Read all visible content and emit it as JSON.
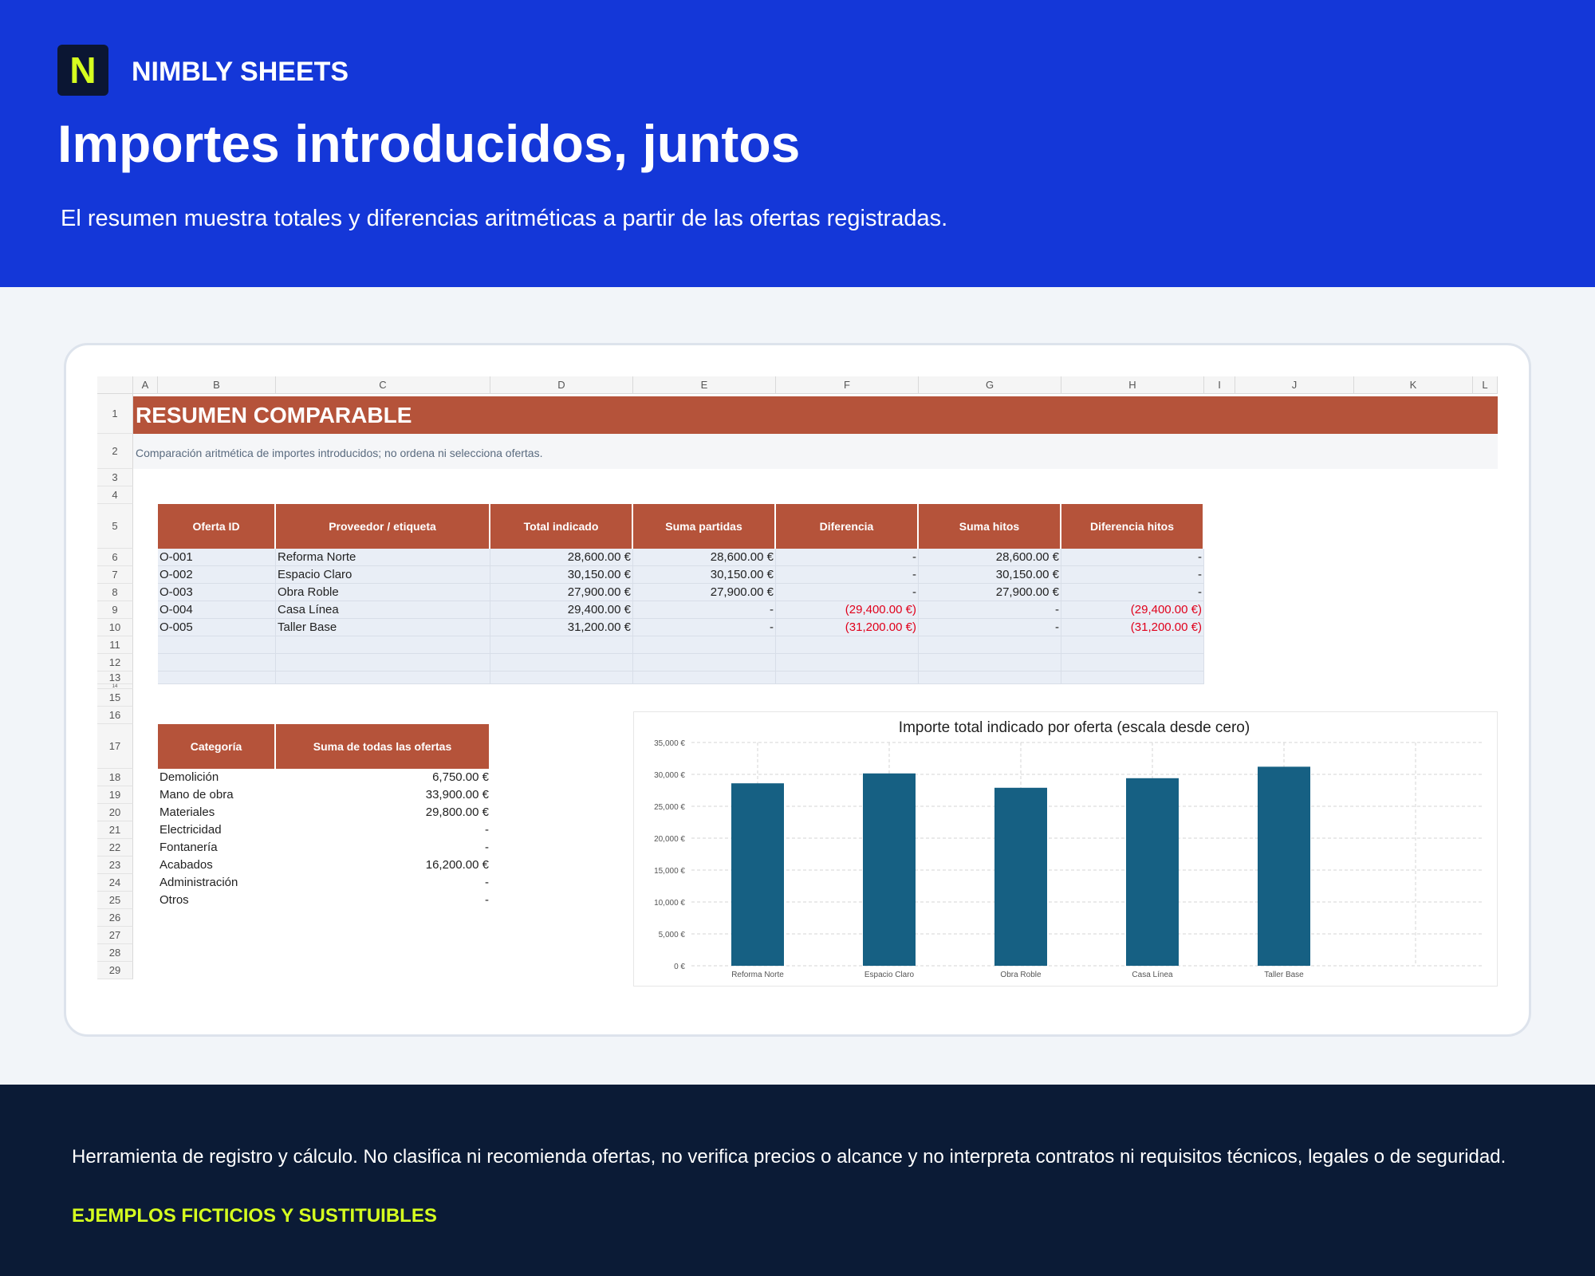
{
  "header": {
    "logo_letter": "N",
    "brand": "NIMBLY SHEETS",
    "title": "Importes introducidos, juntos",
    "subtitle": "El resumen muestra totales y diferencias aritméticas a partir de las ofertas registradas."
  },
  "sheet": {
    "columns": [
      "A",
      "B",
      "C",
      "D",
      "E",
      "F",
      "G",
      "H",
      "I",
      "J",
      "K",
      "L"
    ],
    "rows": [
      "1",
      "2",
      "3",
      "4",
      "5",
      "6",
      "7",
      "8",
      "9",
      "10",
      "11",
      "12",
      "13",
      "14",
      "15",
      "16",
      "17",
      "18",
      "19",
      "20",
      "21",
      "22",
      "23",
      "24",
      "25",
      "26",
      "27",
      "28",
      "29"
    ],
    "banner": "RESUMEN COMPARABLE",
    "note": "Comparación aritmética de importes introducidos; no ordena ni selecciona ofertas.",
    "offers_table": {
      "headers": [
        "Oferta ID",
        "Proveedor / etiqueta",
        "Total indicado",
        "Suma partidas",
        "Diferencia",
        "Suma hitos",
        "Diferencia hitos"
      ],
      "rows": [
        [
          "O-001",
          "Reforma Norte",
          "28,600.00 €",
          "28,600.00 €",
          "-",
          "28,600.00 €",
          "-"
        ],
        [
          "O-002",
          "Espacio Claro",
          "30,150.00 €",
          "30,150.00 €",
          "-",
          "30,150.00 €",
          "-"
        ],
        [
          "O-003",
          "Obra Roble",
          "27,900.00 €",
          "27,900.00 €",
          "-",
          "27,900.00 €",
          "-"
        ],
        [
          "O-004",
          "Casa Línea",
          "29,400.00 €",
          "-",
          "(29,400.00 €)",
          "-",
          "(29,400.00 €)"
        ],
        [
          "O-005",
          "Taller Base",
          "31,200.00 €",
          "-",
          "(31,200.00 €)",
          "-",
          "(31,200.00 €)"
        ],
        [
          "",
          "",
          "",
          "",
          "",
          "",
          ""
        ],
        [
          "",
          "",
          "",
          "",
          "",
          "",
          ""
        ],
        [
          "",
          "",
          "",
          "",
          "",
          "",
          ""
        ]
      ]
    },
    "category_table": {
      "headers": [
        "Categoría",
        "Suma de todas las ofertas"
      ],
      "rows": [
        [
          "Demolición",
          "6,750.00 €"
        ],
        [
          "Mano de obra",
          "33,900.00 €"
        ],
        [
          "Materiales",
          "29,800.00 €"
        ],
        [
          "Electricidad",
          "-"
        ],
        [
          "Fontanería",
          "-"
        ],
        [
          "Acabados",
          "16,200.00 €"
        ],
        [
          "Administración",
          "-"
        ],
        [
          "Otros",
          "-"
        ]
      ]
    }
  },
  "chart_data": {
    "type": "bar",
    "title": "Importe total indicado por oferta (escala desde cero)",
    "categories": [
      "Reforma Norte",
      "Espacio Claro",
      "Obra Roble",
      "Casa Línea",
      "Taller Base"
    ],
    "values": [
      28600,
      30150,
      27900,
      29400,
      31200
    ],
    "ylim": [
      0,
      35000
    ],
    "yticks": [
      "0 €",
      "5,000 €",
      "10,000 €",
      "15,000 €",
      "20,000 €",
      "25,000 €",
      "30,000 €",
      "35,000 €"
    ],
    "ytick_values": [
      0,
      5000,
      10000,
      15000,
      20000,
      25000,
      30000,
      35000
    ],
    "xlabel": "",
    "ylabel": "",
    "grid": true,
    "bar_color": "#166083"
  },
  "footer": {
    "disclaimer": "Herramienta de registro y cálculo. No clasifica ni recomienda ofertas, no verifica precios o alcance y no interpreta contratos ni requisitos técnicos, legales o de seguridad.",
    "tag": "EJEMPLOS FICTICIOS Y SUSTITUIBLES"
  },
  "colors": {
    "header_bg": "#1437d8",
    "accent": "#d6ff1f",
    "table_header": "#b5533a",
    "negative": "#e0001b",
    "footer_bg": "#0b1b36"
  }
}
